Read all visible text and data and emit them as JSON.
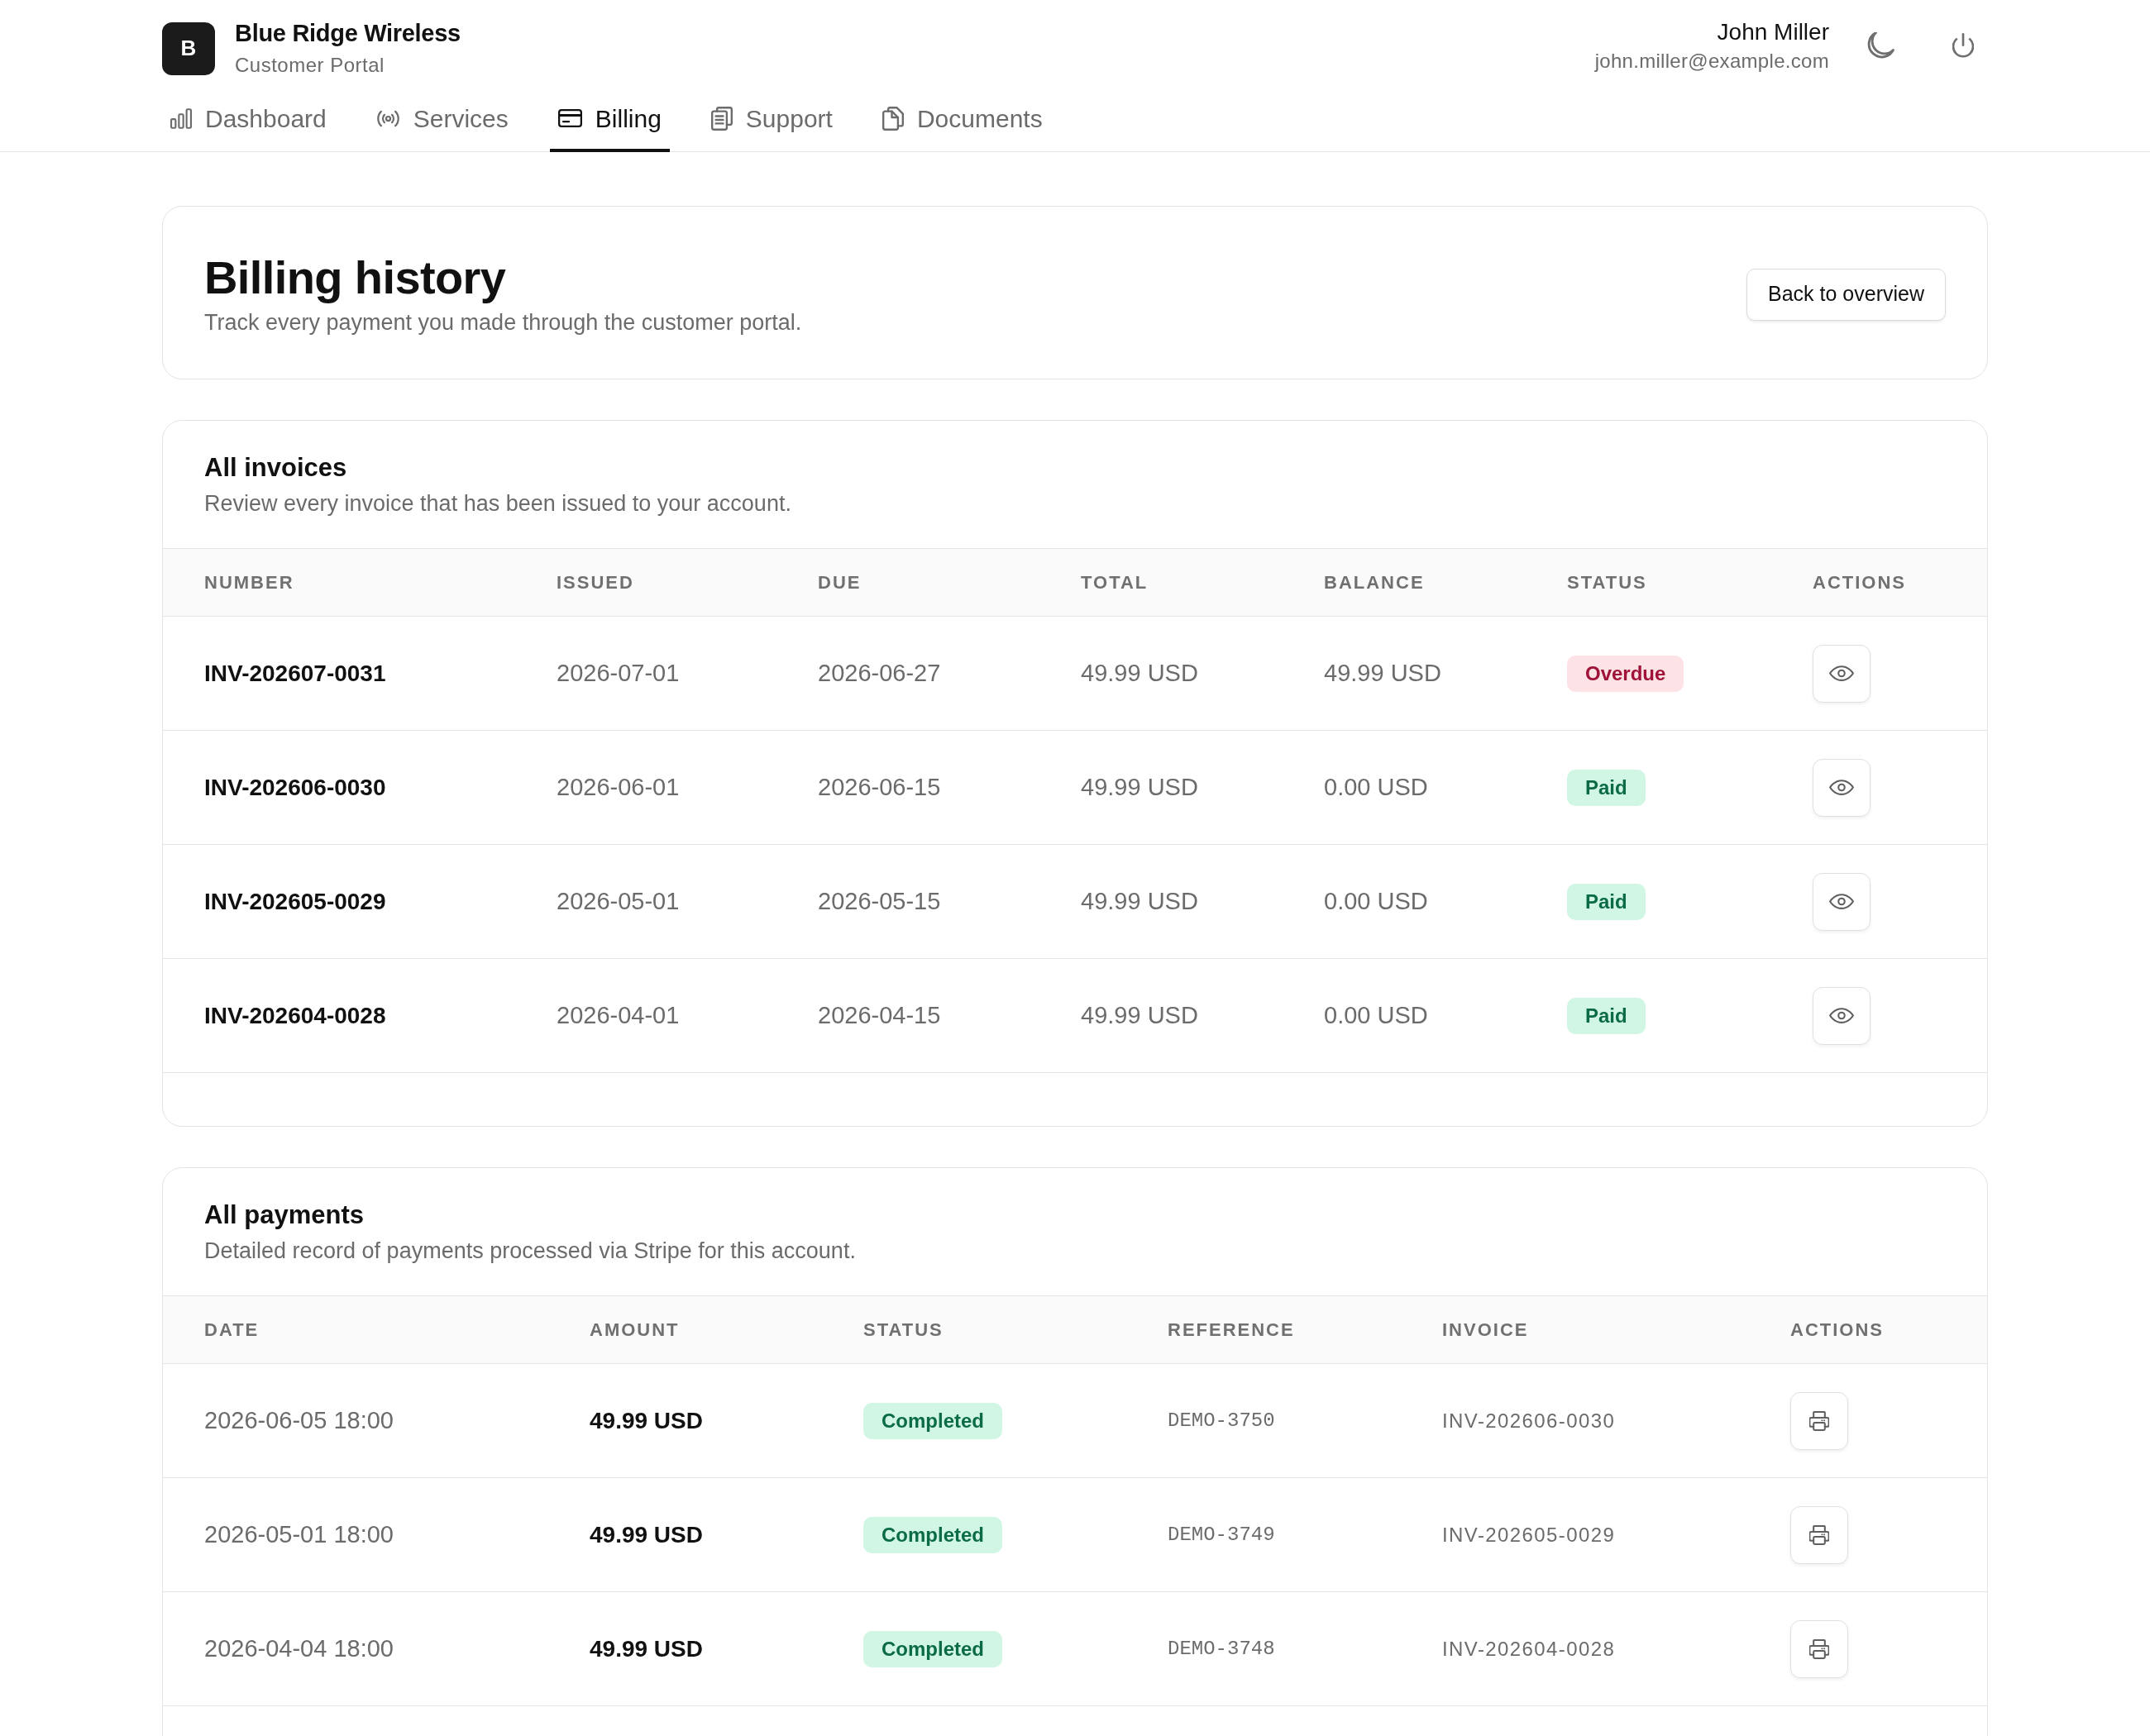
{
  "header": {
    "brand": {
      "logo": "B",
      "name": "Blue Ridge Wireless",
      "tagline": "Customer Portal"
    },
    "user": {
      "name": "John Miller",
      "email": "john.miller@example.com"
    }
  },
  "nav": {
    "tabs": [
      {
        "label": "Dashboard",
        "kind": "dashboard",
        "selected": false
      },
      {
        "label": "Services",
        "kind": "services",
        "selected": false
      },
      {
        "label": "Billing",
        "kind": "billing",
        "selected": true
      },
      {
        "label": "Support",
        "kind": "support",
        "selected": false
      },
      {
        "label": "Documents",
        "kind": "documents",
        "selected": false
      }
    ]
  },
  "page_header": {
    "title": "Billing history",
    "subtitle": "Track every payment you made through the customer portal.",
    "back_button": "Back to overview"
  },
  "invoices": {
    "title": "All invoices",
    "subtitle": "Review every invoice that has been issued to your account.",
    "columns": [
      "NUMBER",
      "ISSUED",
      "DUE",
      "TOTAL",
      "BALANCE",
      "STATUS",
      "ACTIONS"
    ],
    "rows": [
      {
        "number": "INV-202607-0031",
        "issued": "2026-07-01",
        "due": "2026-06-27",
        "total": "49.99 USD",
        "balance": "49.99 USD",
        "status": {
          "text": "Overdue",
          "kind": "danger"
        }
      },
      {
        "number": "INV-202606-0030",
        "issued": "2026-06-01",
        "due": "2026-06-15",
        "total": "49.99 USD",
        "balance": "0.00 USD",
        "status": {
          "text": "Paid",
          "kind": "success"
        }
      },
      {
        "number": "INV-202605-0029",
        "issued": "2026-05-01",
        "due": "2026-05-15",
        "total": "49.99 USD",
        "balance": "0.00 USD",
        "status": {
          "text": "Paid",
          "kind": "success"
        }
      },
      {
        "number": "INV-202604-0028",
        "issued": "2026-04-01",
        "due": "2026-04-15",
        "total": "49.99 USD",
        "balance": "0.00 USD",
        "status": {
          "text": "Paid",
          "kind": "success"
        }
      }
    ]
  },
  "payments": {
    "title": "All payments",
    "subtitle": "Detailed record of payments processed via Stripe for this account.",
    "columns": [
      "DATE",
      "AMOUNT",
      "STATUS",
      "REFERENCE",
      "INVOICE",
      "ACTIONS"
    ],
    "rows": [
      {
        "date": "2026-06-05 18:00",
        "amount": "49.99 USD",
        "status": {
          "text": "Completed",
          "kind": "success"
        },
        "reference": "DEMO-3750",
        "invoice": "INV-202606-0030"
      },
      {
        "date": "2026-05-01 18:00",
        "amount": "49.99 USD",
        "status": {
          "text": "Completed",
          "kind": "success"
        },
        "reference": "DEMO-3749",
        "invoice": "INV-202605-0029"
      },
      {
        "date": "2026-04-04 18:00",
        "amount": "49.99 USD",
        "status": {
          "text": "Completed",
          "kind": "success"
        },
        "reference": "DEMO-3748",
        "invoice": "INV-202604-0028"
      }
    ]
  }
}
